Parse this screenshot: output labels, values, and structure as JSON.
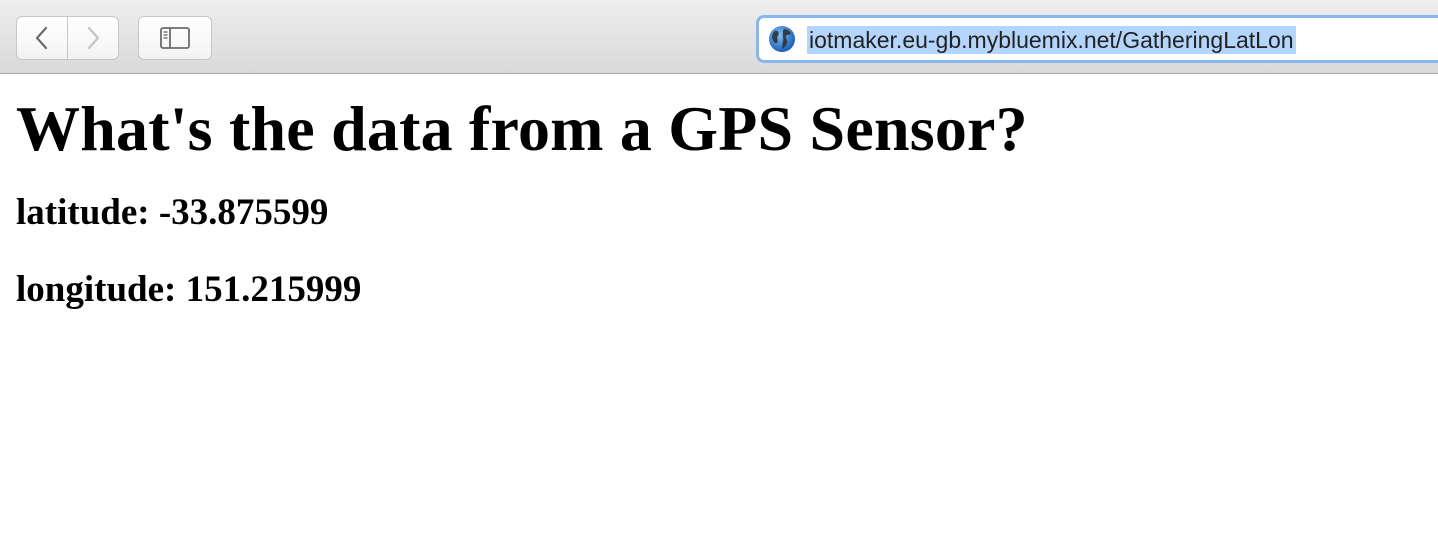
{
  "browser": {
    "url": "iotmaker.eu-gb.mybluemix.net/GatheringLatLon",
    "icons": {
      "back": "chevron-left-icon",
      "forward": "chevron-right-icon",
      "sidebar": "sidebar-icon",
      "site": "globe-icon"
    },
    "colors": {
      "address_focus": "#89b6ec",
      "selection": "#b4d5fe"
    }
  },
  "page": {
    "heading": "What's the data from a GPS Sensor?",
    "latitude": "latitude: -33.875599",
    "longitude": "longitude: 151.215999"
  }
}
